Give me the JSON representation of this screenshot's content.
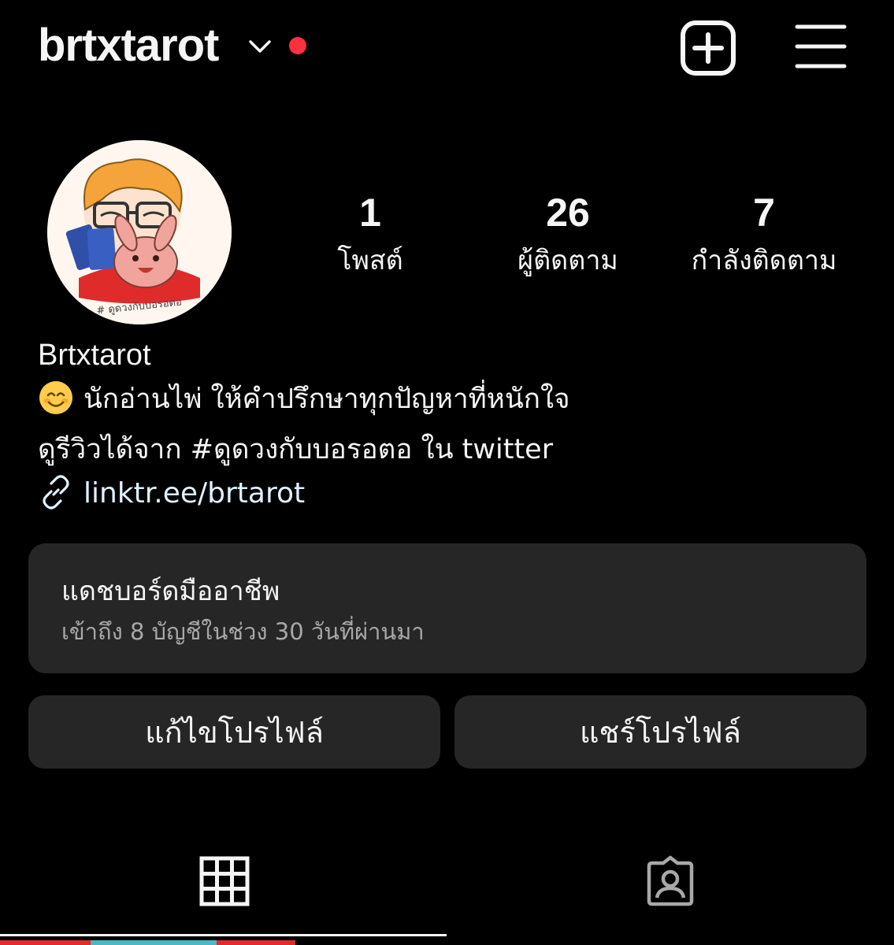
{
  "header": {
    "username": "brtxtarot",
    "icons": [
      "chevron-down-icon",
      "notification-dot",
      "new-post-icon",
      "menu-icon"
    ]
  },
  "stats": {
    "posts": {
      "value": "1",
      "label": "โพสต์"
    },
    "followers": {
      "value": "26",
      "label": "ผู้ติดตาม"
    },
    "following": {
      "value": "7",
      "label": "กำลังติดตาม"
    }
  },
  "profile": {
    "display_name": "Brtxtarot",
    "bio_line1": "นักอ่านไพ่ ให้คำปรึกษาทุกปัญหาที่หนักใจ",
    "bio_line2": "ดูรีวิวได้จาก #ดูดวงกับบอรอตอ ใน twitter",
    "link": "linktr.ee/brtarot",
    "avatar_caption": "# ดูดวงกับบอรอตอ"
  },
  "dashboard": {
    "title": "แดชบอร์ดมืออาชีพ",
    "subtitle": "เข้าถึง 8 บัญชีในช่วง 30 วันที่ผ่านมา"
  },
  "buttons": {
    "edit_profile": "แก้ไขโปรไฟล์",
    "share_profile": "แชร์โปรไฟล์"
  },
  "tabs": [
    {
      "icon": "grid-icon",
      "active": true
    },
    {
      "icon": "tagged-icon",
      "active": false
    }
  ],
  "colors": {
    "background": "#000000",
    "card": "#262626",
    "text": "#f5f5f5",
    "secondary_text": "#a8a8a8",
    "notification": "#ff3040",
    "link": "#e0f1ff"
  }
}
